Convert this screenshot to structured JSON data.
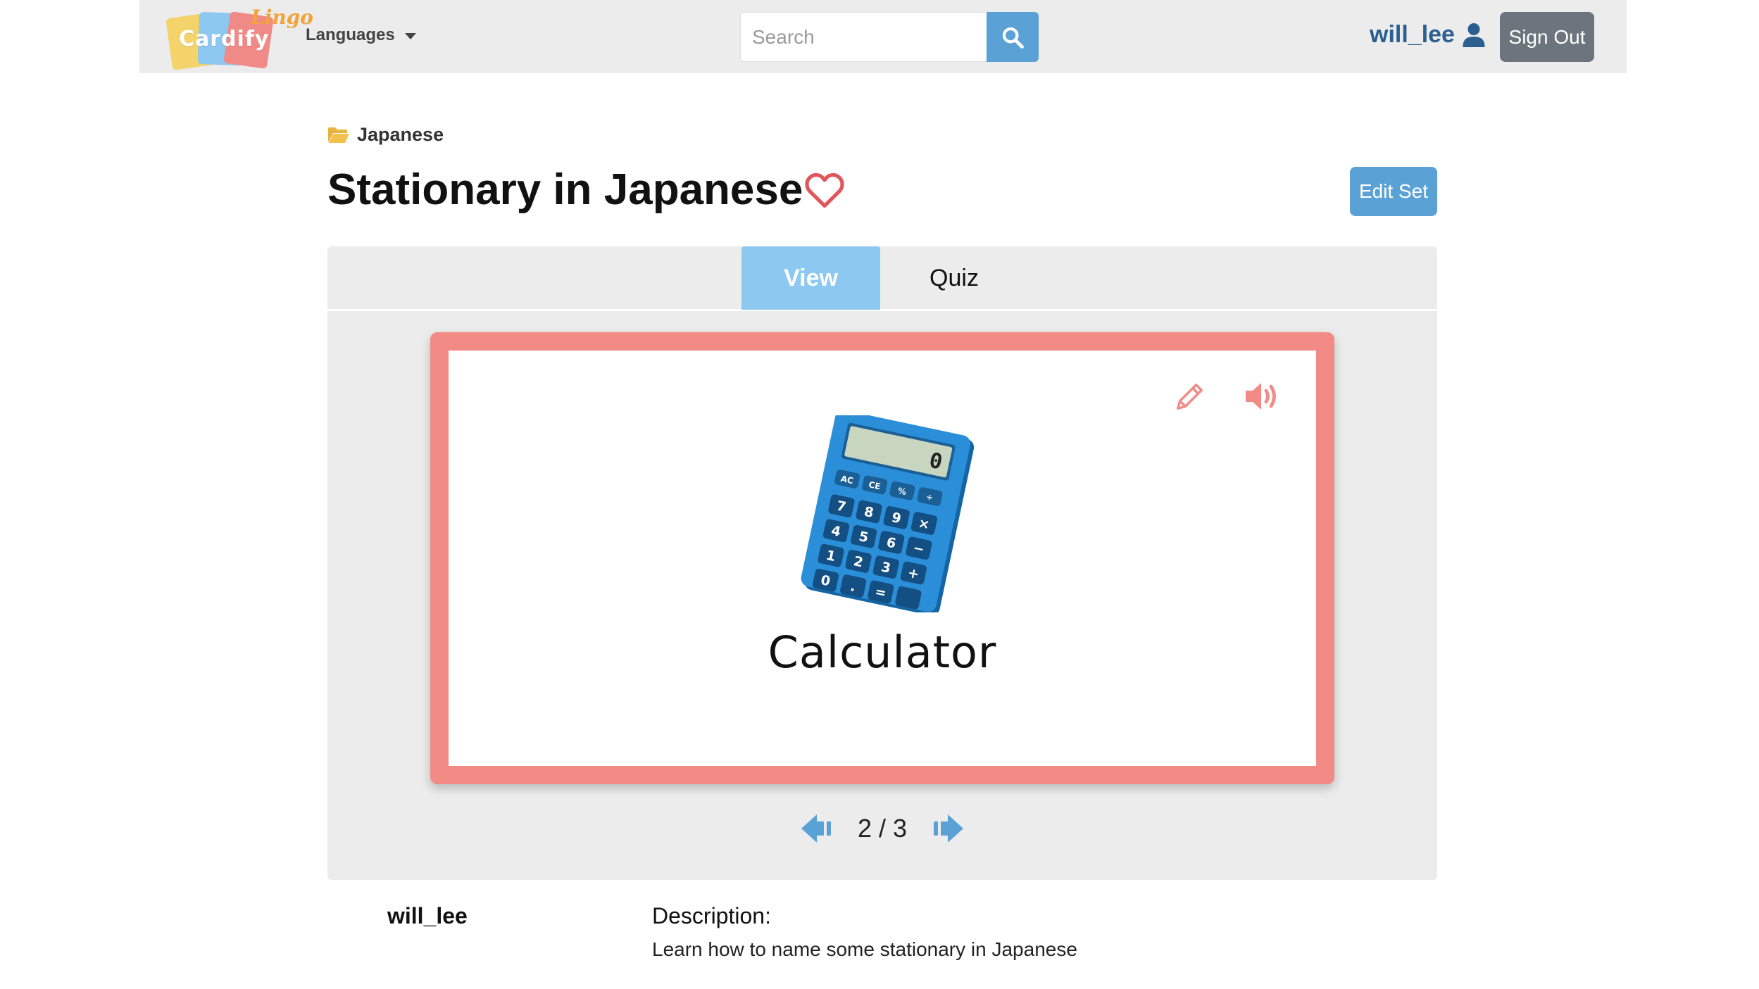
{
  "navbar": {
    "logo_word": "Cardify",
    "logo_word2": "Lingo",
    "languages_label": "Languages",
    "search_placeholder": "Search",
    "username": "will_lee",
    "signout_label": "Sign Out"
  },
  "header": {
    "breadcrumb": "Japanese",
    "title": "Stationary in Japanese",
    "edit_label": "Edit Set"
  },
  "tabs": [
    {
      "label": "View",
      "active": true
    },
    {
      "label": "Quiz",
      "active": false
    }
  ],
  "flashcard": {
    "word": "Calculator",
    "calc_display": "0",
    "calc_keys": [
      "AC",
      "CE",
      "%",
      "÷",
      "7",
      "8",
      "9",
      "×",
      "4",
      "5",
      "6",
      "−",
      "1",
      "2",
      "3",
      "+",
      "0",
      ".",
      "=",
      ""
    ]
  },
  "pager": {
    "text": "2 / 3"
  },
  "footer": {
    "author": "will_lee",
    "description_label": "Description:",
    "description": "Learn how to name some stationary in Japanese"
  },
  "colors": {
    "accent_blue": "#5aa2d6",
    "tab_active": "#8cc8ef",
    "card_border": "#f28a86",
    "heart": "#e0565b",
    "panel_bg": "#ececec",
    "signout": "#6c757d",
    "username": "#2b5f90",
    "folder": "#f2c14e"
  },
  "icons": {
    "search": "search-icon",
    "user": "user-icon",
    "folder": "folder-open-icon",
    "heart": "heart-outline-icon",
    "edit": "pencil-icon",
    "audio": "volume-icon",
    "prev": "arrow-left-icon",
    "next": "arrow-right-icon"
  }
}
